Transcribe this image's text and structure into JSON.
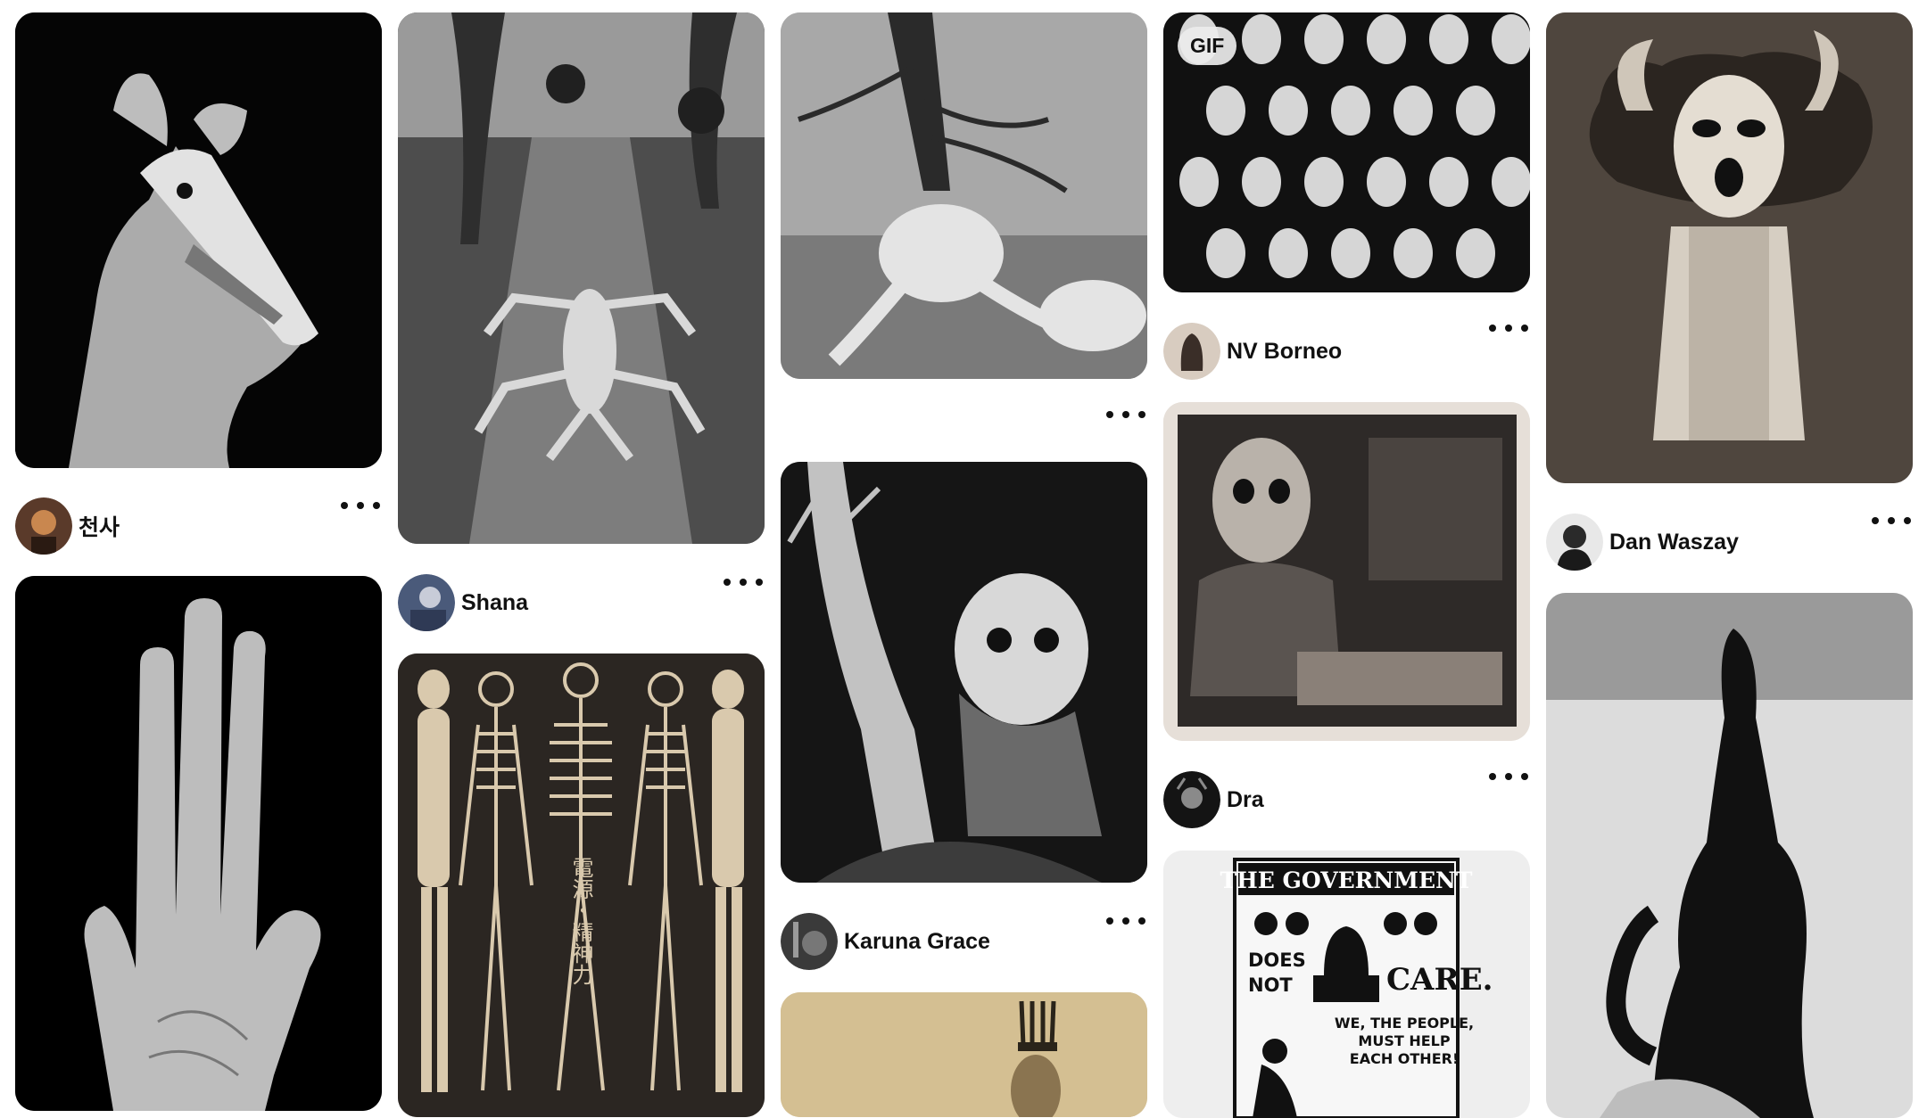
{
  "pins": [
    {
      "id": "pin-dog-creature",
      "creator": "천사",
      "gif": false
    },
    {
      "id": "pin-long-hand",
      "creator": null,
      "gif": false
    },
    {
      "id": "pin-spider-figure",
      "creator": "Shana",
      "gif": false
    },
    {
      "id": "pin-anatomy",
      "creator": null,
      "gif": false
    },
    {
      "id": "pin-tree-figure",
      "creator": null,
      "gif": false
    },
    {
      "id": "pin-owl-mask-girl",
      "creator": "Karuna Grace",
      "gif": false
    },
    {
      "id": "pin-crown-figure",
      "creator": null,
      "gif": false
    },
    {
      "id": "pin-masked-crowd",
      "creator": "NV Borneo",
      "gif": true,
      "badge": "GIF"
    },
    {
      "id": "pin-owl-portrait",
      "creator": "Dra",
      "gif": false
    },
    {
      "id": "pin-government-poster",
      "creator": null,
      "gif": false
    },
    {
      "id": "pin-horned-mask",
      "creator": "Dan Waszay",
      "gif": false
    },
    {
      "id": "pin-ink-head",
      "creator": null,
      "gif": false
    }
  ],
  "poster_text": {
    "line1": "THE GOVERNMENT",
    "line2a": "DOES",
    "line2b": "NOT",
    "line2c": "CARE.",
    "line3a": "WE, THE PEOPLE,",
    "line3b": "MUST HELP",
    "line3c": "EACH OTHER!"
  },
  "anatomy_text": "電源・精神力",
  "creators": {
    "c1": "천사",
    "c2": "Shana",
    "c3": "Karuna Grace",
    "c4": "NV Borneo",
    "c5": "Dra",
    "c6": "Dan Waszay"
  },
  "gif_badge": "GIF"
}
